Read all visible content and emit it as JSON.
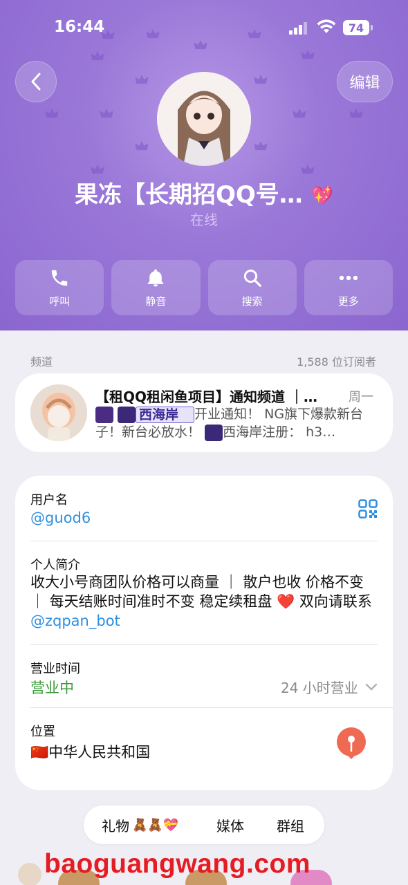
{
  "status_bar": {
    "time": "16:44",
    "battery": "74"
  },
  "header": {
    "edit_label": "编辑",
    "name": "果冻【长期招QQ号…",
    "name_emoji": "💖",
    "status": "在线",
    "accent_color": "#9a78d8"
  },
  "actions": [
    {
      "label": "呼叫",
      "icon": "phone-icon"
    },
    {
      "label": "静音",
      "icon": "bell-icon"
    },
    {
      "label": "搜索",
      "icon": "search-icon"
    },
    {
      "label": "更多",
      "icon": "more-icon"
    }
  ],
  "channel": {
    "section_label": "频道",
    "subscribers": "1,588 位订阅者",
    "title": "【租QQ租闲鱼项目】通知频道 ｜…",
    "day": "周一",
    "preview_tag": "西海岸",
    "preview_text_1": "开业通知！ NG旗下爆款新台子！新台必放水！",
    "preview_text_2": "西海岸注册： h3…"
  },
  "info": {
    "username_label": "用户名",
    "username": "@guod6",
    "bio_label": "个人简介",
    "bio_text": "收大小号商团队价格可以商量 ｜ 散户也收 价格不变 ｜ 每天结账时间准时不变 稳定续租盘 ❤️ 双向请联系 ",
    "bio_link": "@zqpan_bot",
    "hours_label": "营业时间",
    "hours_status": "营业中",
    "hours_detail": "24 小时营业",
    "location_label": "位置",
    "location_flag": "🇨🇳",
    "location": "中华人民共和国"
  },
  "tabs": {
    "gifts": "礼物",
    "gift_emojis": "🧸🧸💝",
    "media": "媒体",
    "groups": "群组"
  },
  "watermark": "baoguangwang.com"
}
